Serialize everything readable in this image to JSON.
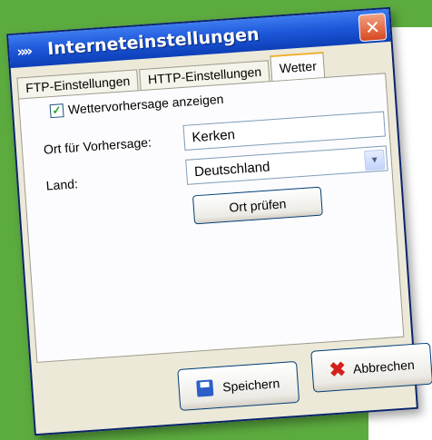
{
  "window": {
    "title": "Interneteinstellungen"
  },
  "tabs": [
    {
      "label": "FTP-Einstellungen"
    },
    {
      "label": "HTTP-Einstellungen"
    },
    {
      "label": "Wetter"
    }
  ],
  "weather": {
    "show_forecast_label": "Wettervorhersage anzeigen",
    "show_forecast_checked": true,
    "location_label": "Ort für Vorhersage:",
    "location_value": "Kerken",
    "country_label": "Land:",
    "country_value": "Deutschland",
    "check_location_button": "Ort prüfen"
  },
  "footer": {
    "save_label": "Speichern",
    "cancel_label": "Abbrechen"
  },
  "icons": {
    "title_icon": "double-chevron-icon",
    "close_icon": "close-icon",
    "save_icon": "floppy-disk-icon",
    "cancel_icon": "red-x-icon"
  }
}
